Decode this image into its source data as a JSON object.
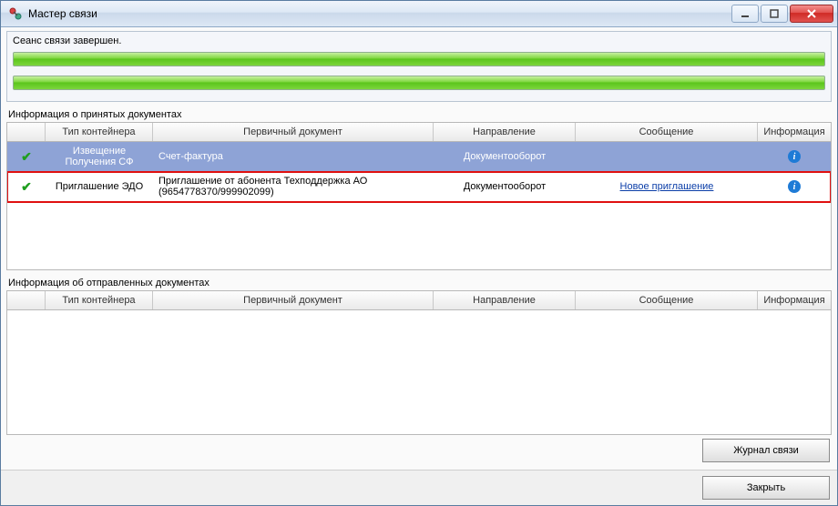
{
  "window": {
    "title": "Мастер связи"
  },
  "session": {
    "status": "Сеанс связи завершен."
  },
  "labels": {
    "received": "Информация о принятых документах",
    "sent": "Информация об отправленных документах"
  },
  "columns": {
    "type": "Тип контейнера",
    "doc": "Первичный документ",
    "dir": "Направление",
    "msg": "Сообщение",
    "info": "Информация"
  },
  "received_rows": [
    {
      "type": "Извещение Получения СФ",
      "doc": "Счет-фактура",
      "dir": "Документооборот",
      "msg": "",
      "msg_is_link": false,
      "selected": true,
      "highlighted": false
    },
    {
      "type": "Приглашение ЭДО",
      "doc": "Приглашение от абонента Техподдержка АО (9654778370/999902099)",
      "dir": "Документооборот",
      "msg": "Новое приглашение",
      "msg_is_link": true,
      "selected": false,
      "highlighted": true
    }
  ],
  "buttons": {
    "journal": "Журнал связи",
    "close": "Закрыть"
  }
}
